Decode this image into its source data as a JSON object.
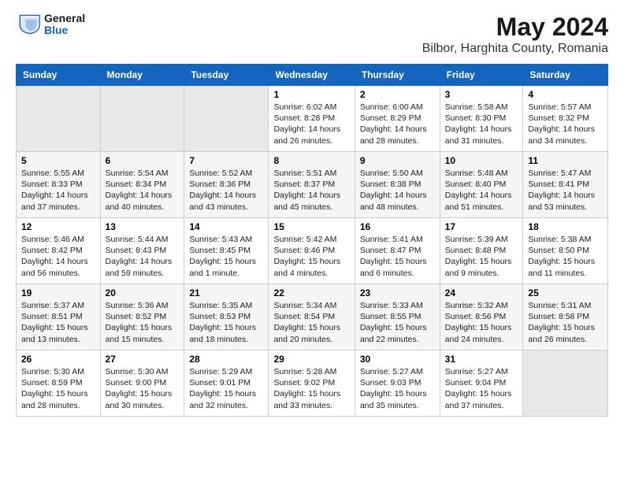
{
  "logo": {
    "general": "General",
    "blue": "Blue"
  },
  "title": "May 2024",
  "subtitle": "Bilbor, Harghita County, Romania",
  "days_of_week": [
    "Sunday",
    "Monday",
    "Tuesday",
    "Wednesday",
    "Thursday",
    "Friday",
    "Saturday"
  ],
  "weeks": [
    [
      {
        "num": "",
        "info": ""
      },
      {
        "num": "",
        "info": ""
      },
      {
        "num": "",
        "info": ""
      },
      {
        "num": "1",
        "info": "Sunrise: 6:02 AM\nSunset: 8:28 PM\nDaylight: 14 hours\nand 26 minutes."
      },
      {
        "num": "2",
        "info": "Sunrise: 6:00 AM\nSunset: 8:29 PM\nDaylight: 14 hours\nand 28 minutes."
      },
      {
        "num": "3",
        "info": "Sunrise: 5:58 AM\nSunset: 8:30 PM\nDaylight: 14 hours\nand 31 minutes."
      },
      {
        "num": "4",
        "info": "Sunrise: 5:57 AM\nSunset: 8:32 PM\nDaylight: 14 hours\nand 34 minutes."
      }
    ],
    [
      {
        "num": "5",
        "info": "Sunrise: 5:55 AM\nSunset: 8:33 PM\nDaylight: 14 hours\nand 37 minutes."
      },
      {
        "num": "6",
        "info": "Sunrise: 5:54 AM\nSunset: 8:34 PM\nDaylight: 14 hours\nand 40 minutes."
      },
      {
        "num": "7",
        "info": "Sunrise: 5:52 AM\nSunset: 8:36 PM\nDaylight: 14 hours\nand 43 minutes."
      },
      {
        "num": "8",
        "info": "Sunrise: 5:51 AM\nSunset: 8:37 PM\nDaylight: 14 hours\nand 45 minutes."
      },
      {
        "num": "9",
        "info": "Sunrise: 5:50 AM\nSunset: 8:38 PM\nDaylight: 14 hours\nand 48 minutes."
      },
      {
        "num": "10",
        "info": "Sunrise: 5:48 AM\nSunset: 8:40 PM\nDaylight: 14 hours\nand 51 minutes."
      },
      {
        "num": "11",
        "info": "Sunrise: 5:47 AM\nSunset: 8:41 PM\nDaylight: 14 hours\nand 53 minutes."
      }
    ],
    [
      {
        "num": "12",
        "info": "Sunrise: 5:46 AM\nSunset: 8:42 PM\nDaylight: 14 hours\nand 56 minutes."
      },
      {
        "num": "13",
        "info": "Sunrise: 5:44 AM\nSunset: 8:43 PM\nDaylight: 14 hours\nand 59 minutes."
      },
      {
        "num": "14",
        "info": "Sunrise: 5:43 AM\nSunset: 8:45 PM\nDaylight: 15 hours\nand 1 minute."
      },
      {
        "num": "15",
        "info": "Sunrise: 5:42 AM\nSunset: 8:46 PM\nDaylight: 15 hours\nand 4 minutes."
      },
      {
        "num": "16",
        "info": "Sunrise: 5:41 AM\nSunset: 8:47 PM\nDaylight: 15 hours\nand 6 minutes."
      },
      {
        "num": "17",
        "info": "Sunrise: 5:39 AM\nSunset: 8:48 PM\nDaylight: 15 hours\nand 9 minutes."
      },
      {
        "num": "18",
        "info": "Sunrise: 5:38 AM\nSunset: 8:50 PM\nDaylight: 15 hours\nand 11 minutes."
      }
    ],
    [
      {
        "num": "19",
        "info": "Sunrise: 5:37 AM\nSunset: 8:51 PM\nDaylight: 15 hours\nand 13 minutes."
      },
      {
        "num": "20",
        "info": "Sunrise: 5:36 AM\nSunset: 8:52 PM\nDaylight: 15 hours\nand 15 minutes."
      },
      {
        "num": "21",
        "info": "Sunrise: 5:35 AM\nSunset: 8:53 PM\nDaylight: 15 hours\nand 18 minutes."
      },
      {
        "num": "22",
        "info": "Sunrise: 5:34 AM\nSunset: 8:54 PM\nDaylight: 15 hours\nand 20 minutes."
      },
      {
        "num": "23",
        "info": "Sunrise: 5:33 AM\nSunset: 8:55 PM\nDaylight: 15 hours\nand 22 minutes."
      },
      {
        "num": "24",
        "info": "Sunrise: 5:32 AM\nSunset: 8:56 PM\nDaylight: 15 hours\nand 24 minutes."
      },
      {
        "num": "25",
        "info": "Sunrise: 5:31 AM\nSunset: 8:58 PM\nDaylight: 15 hours\nand 26 minutes."
      }
    ],
    [
      {
        "num": "26",
        "info": "Sunrise: 5:30 AM\nSunset: 8:59 PM\nDaylight: 15 hours\nand 28 minutes."
      },
      {
        "num": "27",
        "info": "Sunrise: 5:30 AM\nSunset: 9:00 PM\nDaylight: 15 hours\nand 30 minutes."
      },
      {
        "num": "28",
        "info": "Sunrise: 5:29 AM\nSunset: 9:01 PM\nDaylight: 15 hours\nand 32 minutes."
      },
      {
        "num": "29",
        "info": "Sunrise: 5:28 AM\nSunset: 9:02 PM\nDaylight: 15 hours\nand 33 minutes."
      },
      {
        "num": "30",
        "info": "Sunrise: 5:27 AM\nSunset: 9:03 PM\nDaylight: 15 hours\nand 35 minutes."
      },
      {
        "num": "31",
        "info": "Sunrise: 5:27 AM\nSunset: 9:04 PM\nDaylight: 15 hours\nand 37 minutes."
      },
      {
        "num": "",
        "info": ""
      }
    ]
  ]
}
